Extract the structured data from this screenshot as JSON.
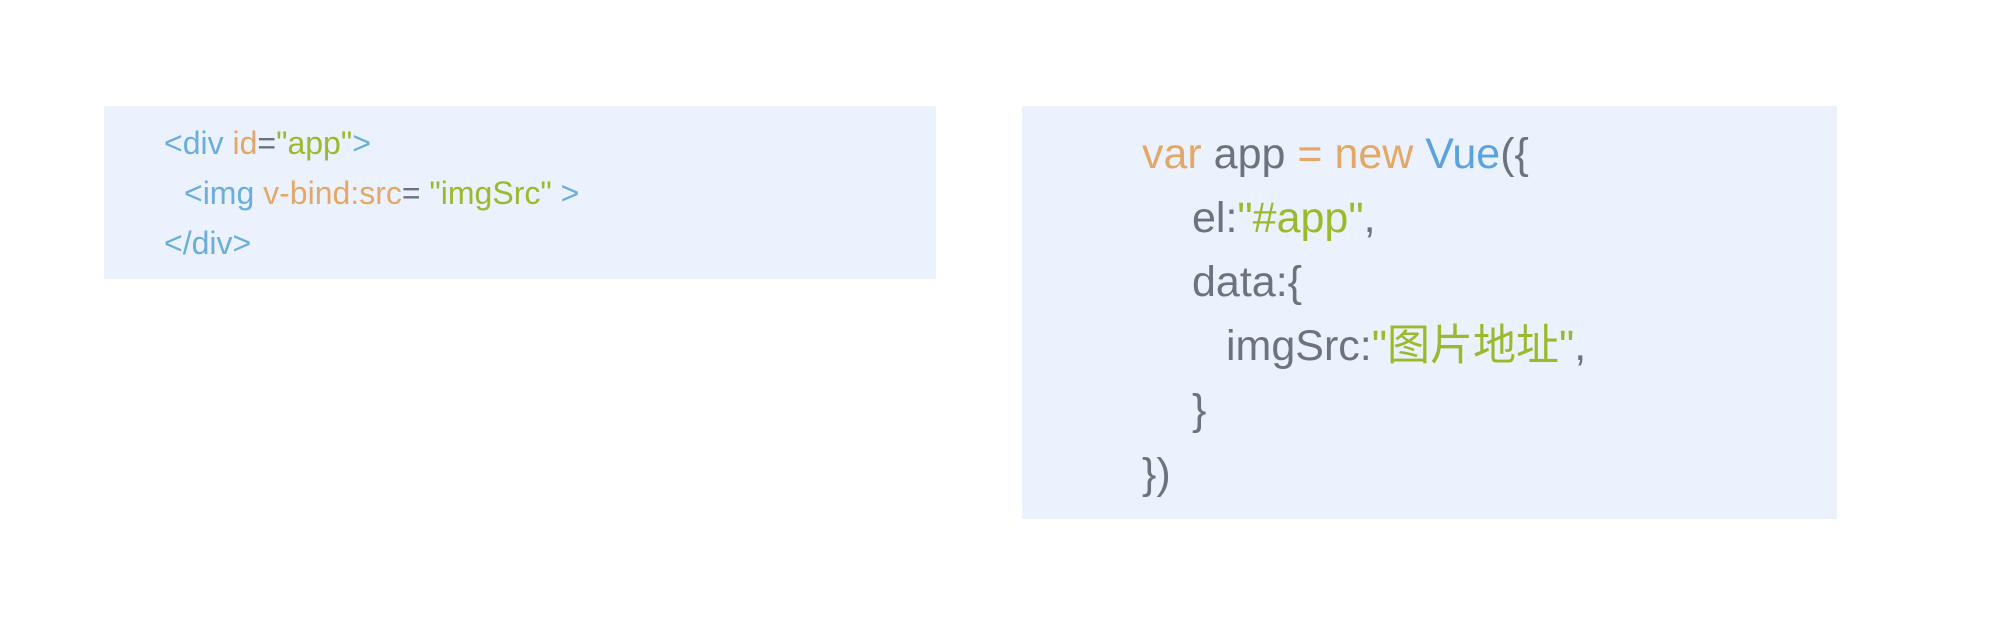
{
  "html_block": {
    "line1": {
      "open": "<div ",
      "attr": "id",
      "eq": "=",
      "value": "\"app\"",
      "close": ">"
    },
    "line2": {
      "open": "<img ",
      "attr": "v-bind:src",
      "eq": "= ",
      "value": "\"imgSrc\"",
      "close": " >"
    },
    "line3": {
      "close_tag": "</div>"
    }
  },
  "js_block": {
    "line1": {
      "kw_var": "var",
      "ident": " app ",
      "op": "=",
      "kw_new": " new ",
      "fn": "Vue",
      "punct": "({"
    },
    "line2": {
      "key": "el:",
      "value": "\"#app\"",
      "punct": ","
    },
    "line3": {
      "key": "data:{"
    },
    "line4": {
      "key": "imgSrc:",
      "quote_open": "\"",
      "value": "图片地址",
      "quote_close": "\"",
      "punct": ","
    },
    "line5": {
      "text": "}"
    },
    "line6": {
      "text": "})"
    }
  },
  "colors": {
    "panel_background": "#ecf2fd",
    "tag": "#6aaedc",
    "attribute": "#e3a868",
    "string": "#9ab92e",
    "plain": "#6b737d",
    "function": "#5ba3de"
  }
}
